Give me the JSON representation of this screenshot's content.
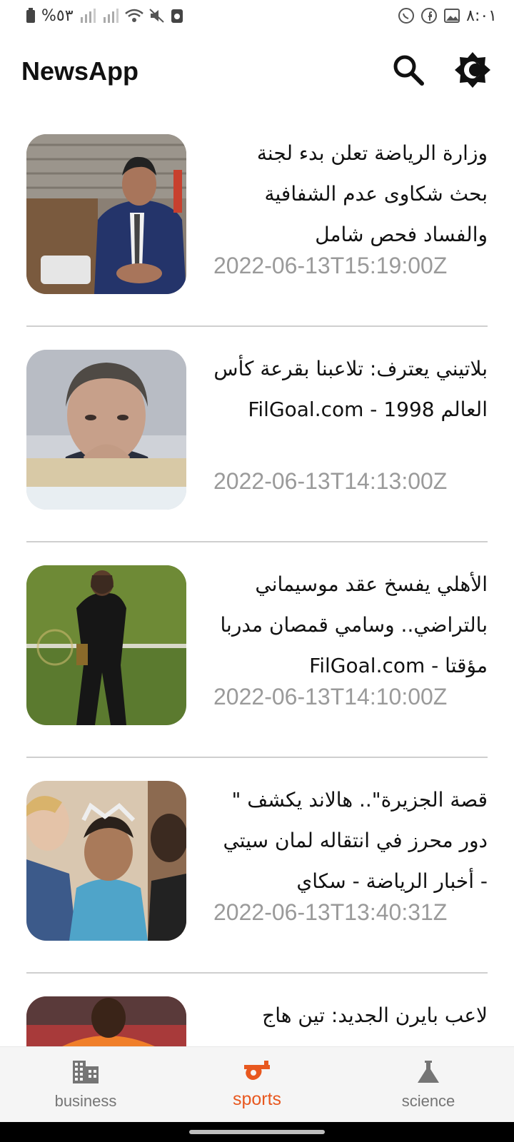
{
  "status_bar": {
    "battery_text": "%٥٣",
    "time": "٨:٠١",
    "icons_left": [
      "battery-icon",
      "signal-icon",
      "signal-icon",
      "wifi-icon",
      "mute-icon",
      "recycle-icon"
    ],
    "icons_right": [
      "whatsapp-icon",
      "facebook-icon",
      "gallery-icon"
    ]
  },
  "app_bar": {
    "title": "NewsApp",
    "actions": [
      "search-icon",
      "brightness-icon"
    ]
  },
  "articles": [
    {
      "title": "وزارة الرياضة تعلن بدء لجنة بحث شكاوى عدم الشفافية والفساد فحص شامل",
      "date": "2022-06-13T15:19:00Z"
    },
    {
      "title": "بلاتيني يعترف: تلاعبنا بقرعة كأس العالم 1998 - FilGoal.com",
      "date": "2022-06-13T14:13:00Z"
    },
    {
      "title": "الأهلي يفسخ عقد موسيماني بالتراضي.. وسامي قمصان مدربا مؤقتا - FilGoal.com",
      "date": "2022-06-13T14:10:00Z"
    },
    {
      "title": "قصة الجزيرة\".. هالاند يكشف \" دور محرز في انتقاله لمان سيتي - أخبار الرياضة - سكاي",
      "date": "2022-06-13T13:40:31Z"
    },
    {
      "title": "لاعب بايرن الجديد: تين هاج",
      "date": ""
    }
  ],
  "bottom_nav": {
    "items": [
      {
        "label": "business",
        "icon": "business-icon",
        "active": false
      },
      {
        "label": "sports",
        "icon": "sports-icon",
        "active": true
      },
      {
        "label": "science",
        "icon": "science-icon",
        "active": false
      }
    ],
    "accent_color": "#e8581f",
    "inactive_color": "#757575"
  }
}
